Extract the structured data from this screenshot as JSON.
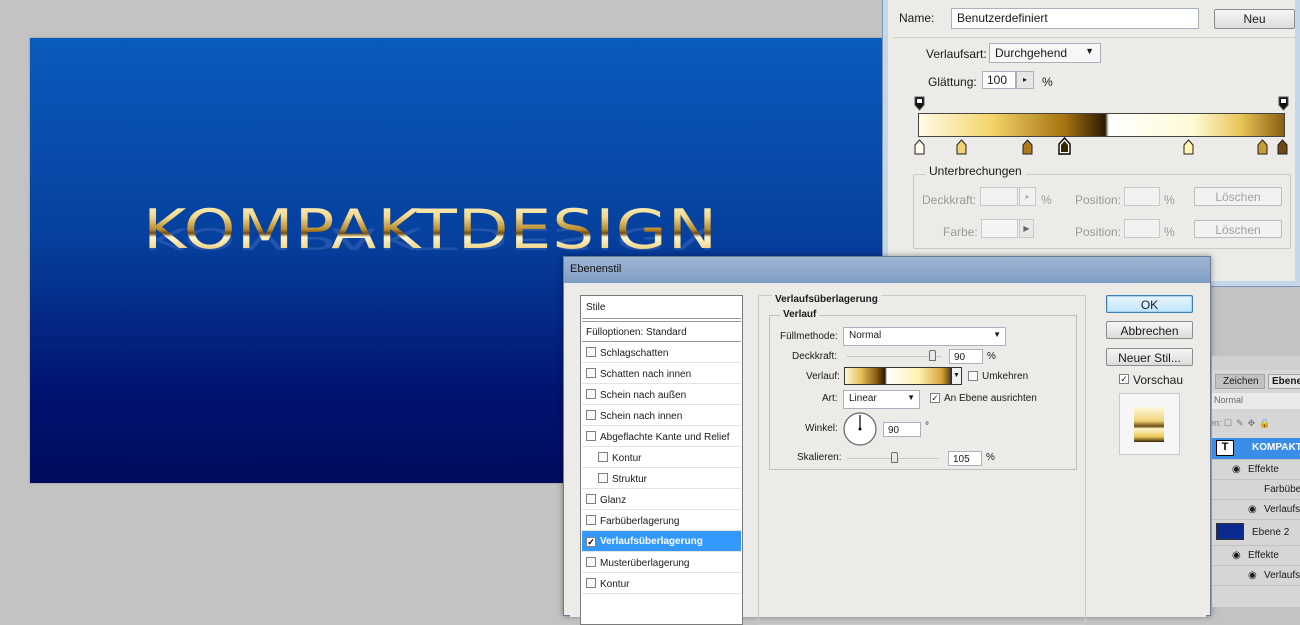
{
  "canvas": {
    "text": "KOMPAKTDESIGN"
  },
  "gradient_editor": {
    "name_label": "Name:",
    "name_value": "Benutzerdefiniert",
    "new_button": "Neu",
    "type_label": "Verlaufsart:",
    "type_value": "Durchgehend",
    "smooth_label": "Glättung:",
    "smooth_value": "100",
    "smooth_unit": "%",
    "stops_group": "Unterbrechungen",
    "opacity_label": "Deckkraft:",
    "opacity_unit": "%",
    "position_label": "Position:",
    "position_unit": "%",
    "delete_button": "Löschen",
    "color_label": "Farbe:",
    "position2_label": "Position:",
    "position2_unit": "%",
    "delete2_button": "Löschen"
  },
  "layer_style": {
    "title": "Ebenenstil",
    "list_header": "Stile",
    "items": [
      {
        "label": "Fülloptionen: Standard",
        "checkbox": false,
        "checked": false
      },
      {
        "label": "Schlagschatten",
        "checkbox": true,
        "checked": false
      },
      {
        "label": "Schatten nach innen",
        "checkbox": true,
        "checked": false
      },
      {
        "label": "Schein nach außen",
        "checkbox": true,
        "checked": false
      },
      {
        "label": "Schein nach innen",
        "checkbox": true,
        "checked": false
      },
      {
        "label": "Abgeflachte Kante und Relief",
        "checkbox": true,
        "checked": false
      },
      {
        "label": "Kontur",
        "checkbox": true,
        "checked": false
      },
      {
        "label": "Struktur",
        "checkbox": true,
        "checked": false
      },
      {
        "label": "Glanz",
        "checkbox": true,
        "checked": false
      },
      {
        "label": "Farbüberlagerung",
        "checkbox": true,
        "checked": false
      },
      {
        "label": "Verlaufsüberlagerung",
        "checkbox": true,
        "checked": true
      },
      {
        "label": "Musterüberlagerung",
        "checkbox": true,
        "checked": false
      },
      {
        "label": "Kontur",
        "checkbox": true,
        "checked": false
      }
    ],
    "section_title": "Verlaufsüberlagerung",
    "group_title": "Verlauf",
    "blend_label": "Füllmethode:",
    "blend_value": "Normal",
    "opacity_label": "Deckkraft:",
    "opacity_value": "90",
    "opacity_unit": "%",
    "opacity_level": 0.9,
    "gradient_label": "Verlauf:",
    "reverse_label": "Umkehren",
    "style_label": "Art:",
    "style_value": "Linear",
    "align_label": "An Ebene ausrichten",
    "angle_label": "Winkel:",
    "angle_value": "90",
    "angle_unit": "°",
    "scale_label": "Skalieren:",
    "scale_value": "105",
    "scale_unit": "%",
    "scale_level": 0.525,
    "ok": "OK",
    "cancel": "Abbrechen",
    "new_style": "Neuer Stil...",
    "preview_label": "Vorschau"
  },
  "layers_panel": {
    "tab1": "Zeichen",
    "tab2": "Ebenen",
    "blend": "Normal",
    "lock_label": "Fixieren:",
    "rows": [
      "KOMPAKTDESIGN",
      "Effekte",
      "Farbüberlagerung",
      "Verlaufsüberlagerung",
      "Ebene 2",
      "Effekte",
      "Verlaufsüberlagerung"
    ]
  }
}
